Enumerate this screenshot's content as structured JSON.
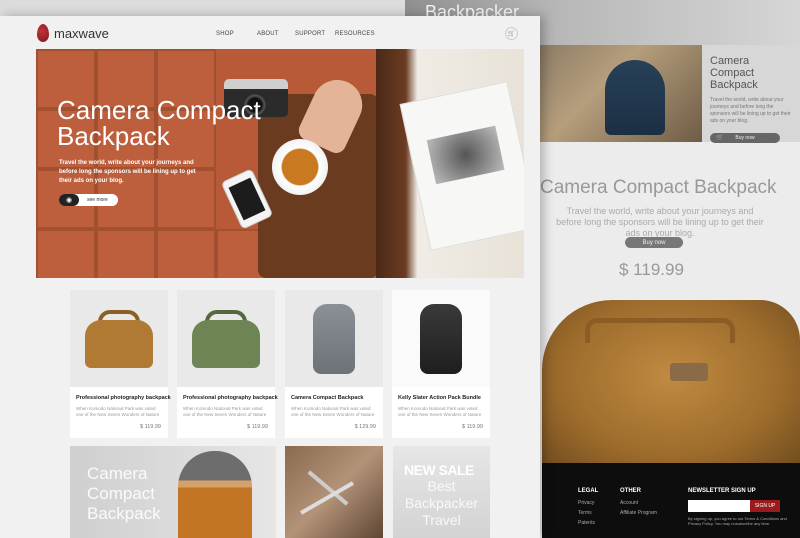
{
  "back": {
    "top_text": "Backpacker",
    "card": {
      "title": "Camera Compact Backpack",
      "text": "Travel the world, write about your journeys and before long the sponsors will be lining up to get their ads on your blog.",
      "button": "Buy now"
    },
    "hero": {
      "title": "Camera Compact Backpack",
      "text": "Travel the world, write about your journeys and before long the sponsors will be lining up to get their ads on your blog.",
      "button": "Buy now",
      "price": "$ 119.99"
    },
    "footer": {
      "legal": {
        "heading": "LEGAL",
        "links": [
          "Privacy",
          "Terms",
          "Patents"
        ]
      },
      "other": {
        "heading": "OTHER",
        "links": [
          "Account",
          "Affiliate Program"
        ]
      },
      "newsletter": {
        "heading": "NEWSLETTER SIGN UP",
        "button": "SIGN UP",
        "note": "By signing up, you agree to our Terms & Conditions and Privacy Policy. You may unsubscribe any time."
      }
    }
  },
  "brand": {
    "name": "maxwave"
  },
  "nav": {
    "items": [
      "SHOP",
      "ABOUT",
      "SUPPORT",
      "RESOURCES"
    ]
  },
  "hero": {
    "title": "Camera Compact Backpack",
    "text": "Travel the world, write about your journeys and before long the sponsors will be lining up to get their ads on your blog.",
    "button": "see more"
  },
  "products": [
    {
      "title": "Professional photography backpack",
      "desc": "When Komodo National Park was voted one of the New Seven Wonders of Nature",
      "price": "$ 119.99",
      "color": "#b07a34"
    },
    {
      "title": "Professional photography backpack",
      "desc": "When Komodo National Park was voted one of the New Seven Wonders of Nature",
      "price": "$ 119.99",
      "color": "#6f8455"
    },
    {
      "title": "Camera Compact Backpack",
      "desc": "When Komodo National Park was voted one of the New Seven Wonders of Nature",
      "price": "$ 129.99",
      "color": "#7d8288"
    },
    {
      "title": "Kelly Slater Action Pack Bundle",
      "desc": "When Komodo National Park was voted one of the New Seven Wonders of Nature",
      "price": "$ 119.99",
      "color": "#2a2a2a"
    }
  ],
  "banners": {
    "b1": "Camera Compact Backpack",
    "b3_sale": "NEW SALE",
    "b3_sub": "Best Backpacker Travel"
  }
}
